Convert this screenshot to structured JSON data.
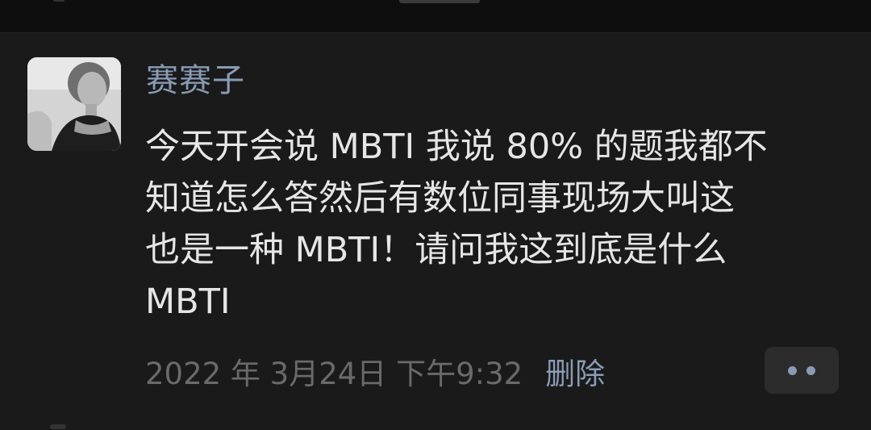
{
  "post": {
    "username": "赛赛子",
    "text_lines": [
      "今天开会说 MBTI 我说 80% 的题我都不",
      "知道怎么答然后有数位同事现场大叫这",
      "也是一种 MBTI！请问我这到底是什么",
      "MBTI"
    ],
    "timestamp": "2022 年 3月24日 下午9:32",
    "delete_label": "删除"
  },
  "icons": {
    "more": "more-dots-icon",
    "avatar": "user-avatar-photo"
  },
  "colors": {
    "background": "#1a1a1a",
    "username": "#8a9bb5",
    "text": "#e6e6e6",
    "timestamp": "#6a6a6a",
    "link": "#8a9bb5"
  }
}
